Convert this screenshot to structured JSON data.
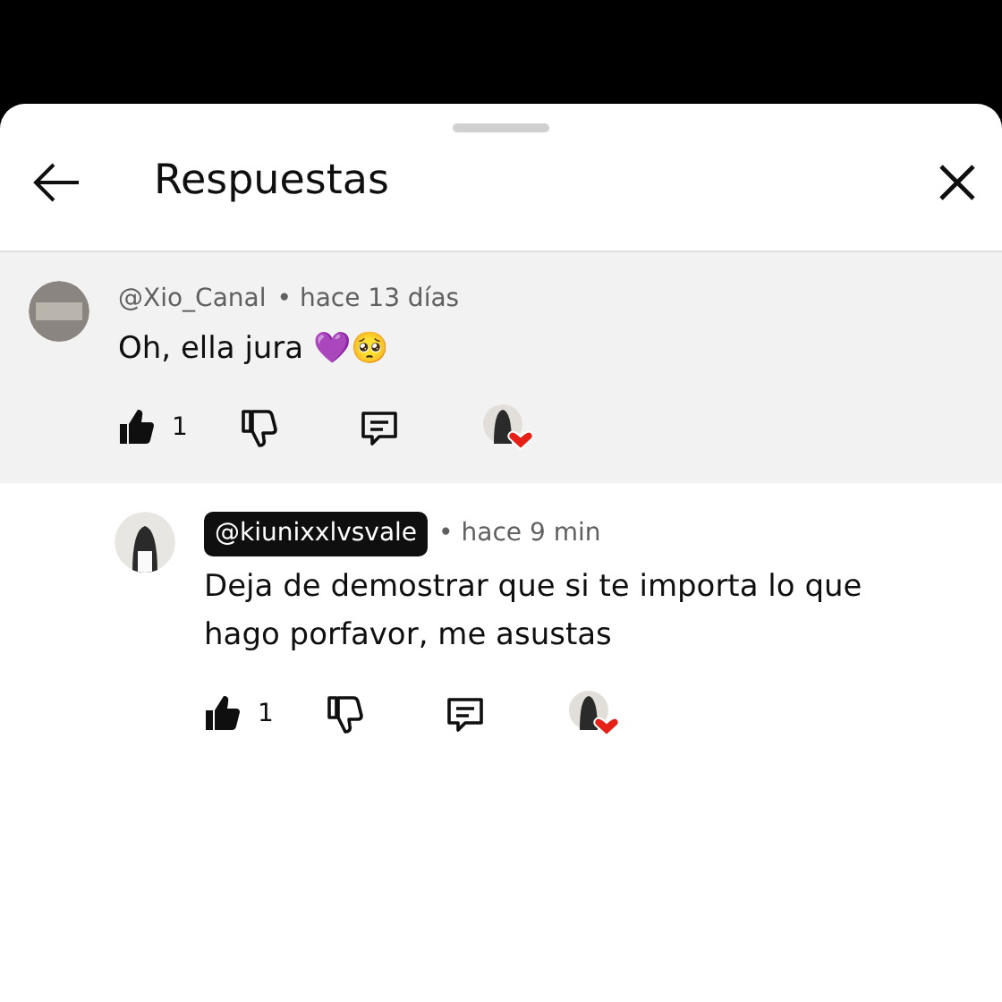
{
  "header": {
    "title": "Respuestas"
  },
  "comments": [
    {
      "kind": "parent",
      "author": "@Xio_Canal",
      "author_badge": false,
      "time": "• hace 13 días",
      "text": "Oh, ella jura 💜🥺",
      "liked": true,
      "likes": "1",
      "creator_heart": true
    },
    {
      "kind": "reply",
      "author": "@kiunixxlvsvale",
      "author_badge": true,
      "time": "• hace 9 min",
      "text": "Deja de demostrar que si te importa lo que hago porfavor, me asustas",
      "liked": true,
      "likes": "1",
      "creator_heart": true
    }
  ]
}
